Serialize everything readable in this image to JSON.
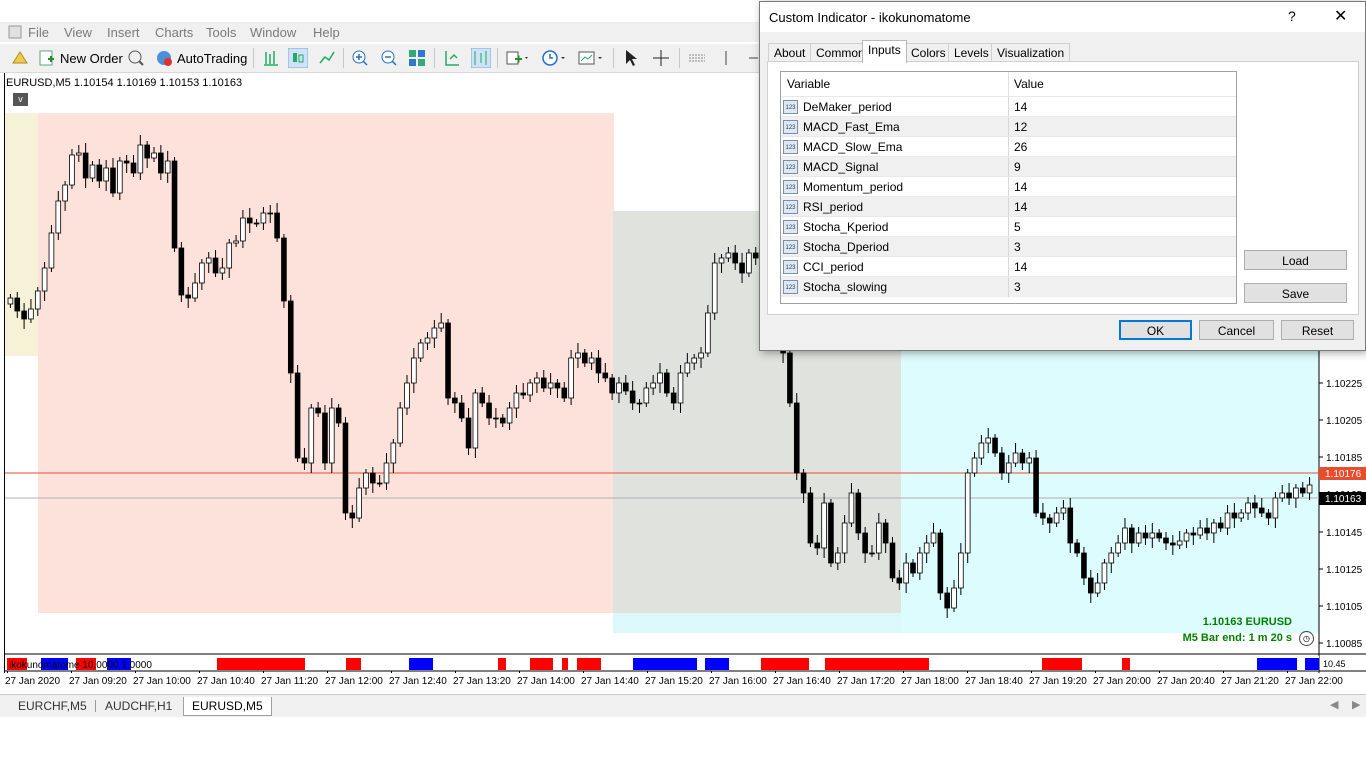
{
  "menu": [
    "File",
    "View",
    "Insert",
    "Charts",
    "Tools",
    "Window",
    "Help"
  ],
  "toolbar": {
    "new_order": "New Order",
    "autotrading": "AutoTrading"
  },
  "chart": {
    "header": "EURUSD,M5  1.10154 1.10169 1.10153 1.10163",
    "collapse": "v",
    "price_labels": [
      "1.10225",
      "1.10205",
      "1.10185",
      "1.10165",
      "1.10145",
      "1.10125",
      "1.10105",
      "1.10085"
    ],
    "current_price_tag": "1.10176",
    "bid_price_tag": "1.10163",
    "time_labels": [
      "27 Jan 2020",
      "27 Jan 09:20",
      "27 Jan 10:00",
      "27 Jan 10:40",
      "27 Jan 11:20",
      "27 Jan 12:00",
      "27 Jan 12:40",
      "27 Jan 13:20",
      "27 Jan 14:00",
      "27 Jan 14:40",
      "27 Jan 15:20",
      "27 Jan 16:00",
      "27 Jan 16:40",
      "27 Jan 17:20",
      "27 Jan 18:00",
      "27 Jan 18:40",
      "27 Jan 19:20",
      "27 Jan 20:00",
      "27 Jan 20:40",
      "27 Jan 21:20",
      "27 Jan 22:00"
    ],
    "indicator_label": "ikokunomatome 10.0000 1.0000",
    "indicator_scale": "10.45",
    "price_info_line1": "1.10163  EURUSD",
    "price_info_line2": "M5 Bar end: 1 m 20 s",
    "colors": {
      "line_red": "#e84c2c",
      "up_bar": "#ffffff",
      "down_bar": "#000000",
      "signal_red": "#ff0000",
      "signal_blue": "#0000ff"
    }
  },
  "bottom_tabs": [
    "EURCHF,M5",
    "AUDCHF,H1",
    "EURUSD,M5"
  ],
  "dialog": {
    "title": "Custom Indicator - ikokunomatome",
    "help": "?",
    "close": "✕",
    "tabs": [
      "About",
      "Common",
      "Inputs",
      "Colors",
      "Levels",
      "Visualization"
    ],
    "active_tab": "Inputs",
    "columns": [
      "Variable",
      "Value"
    ],
    "icon_text": "123",
    "rows": [
      {
        "variable": "DeMaker_period",
        "value": "14"
      },
      {
        "variable": "MACD_Fast_Ema",
        "value": "12"
      },
      {
        "variable": "MACD_Slow_Ema",
        "value": "26"
      },
      {
        "variable": "MACD_Signal",
        "value": "9"
      },
      {
        "variable": "Momentum_period",
        "value": "14"
      },
      {
        "variable": "RSI_period",
        "value": "14"
      },
      {
        "variable": "Stocha_Kperiod",
        "value": "5"
      },
      {
        "variable": "Stocha_Dperiod",
        "value": "3"
      },
      {
        "variable": "CCI_period",
        "value": "14"
      },
      {
        "variable": "Stocha_slowing",
        "value": "3"
      }
    ],
    "buttons": {
      "load": "Load",
      "save": "Save",
      "ok": "OK",
      "cancel": "Cancel",
      "reset": "Reset"
    }
  }
}
